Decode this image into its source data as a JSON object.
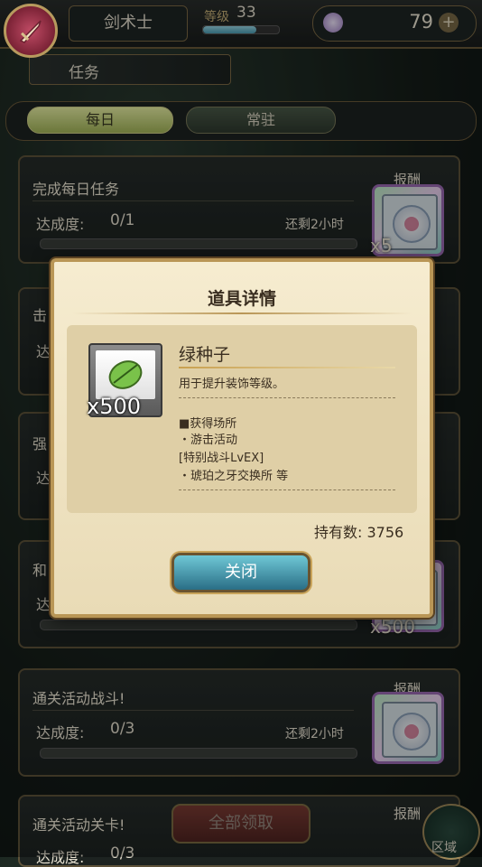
{
  "header": {
    "job": "剑术士",
    "level_label": "等级",
    "level": "33",
    "level_progress": 0.7,
    "gem_count": "79",
    "plus": "+"
  },
  "section": {
    "title": "任务"
  },
  "tabs": [
    {
      "label": "每日",
      "active": true
    },
    {
      "label": "常驻",
      "active": false
    }
  ],
  "quests": [
    {
      "title": "完成每日任务",
      "progress_label": "达成度:",
      "progress": "0/1",
      "remaining": "还剩2小时",
      "reward_label": "报酬",
      "reward_qty": "x5"
    },
    {
      "title": "击",
      "progress_label": "达",
      "progress": "",
      "remaining": "",
      "reward_label": "",
      "reward_qty": ""
    },
    {
      "title": "强",
      "progress_label": "达",
      "progress": "",
      "remaining": "",
      "reward_label": "",
      "reward_qty": ""
    },
    {
      "title": "和",
      "progress_label": "达",
      "progress": "",
      "remaining": "",
      "reward_label": "",
      "reward_qty": "x500"
    },
    {
      "title": "通关活动战斗!",
      "progress_label": "达成度:",
      "progress": "0/3",
      "remaining": "还剩2小时",
      "reward_label": "报酬",
      "reward_qty": ""
    },
    {
      "title": "通关活动关卡!",
      "progress_label": "达成度:",
      "progress": "0/3",
      "remaining": "",
      "reward_label": "报酬",
      "reward_qty": ""
    }
  ],
  "footer": {
    "claim_all": "全部领取",
    "area": "区域"
  },
  "modal": {
    "title": "道具详情",
    "item_name": "绿种子",
    "item_qty": "x500",
    "description": "用于提升装饰等级。",
    "source_header": "■获得场所",
    "sources": [
      "・游击活动",
      "[特别战斗LvEX]",
      "・琥珀之牙交换所 等"
    ],
    "hold_label": "持有数:",
    "hold_value": "3756",
    "close": "关闭"
  }
}
